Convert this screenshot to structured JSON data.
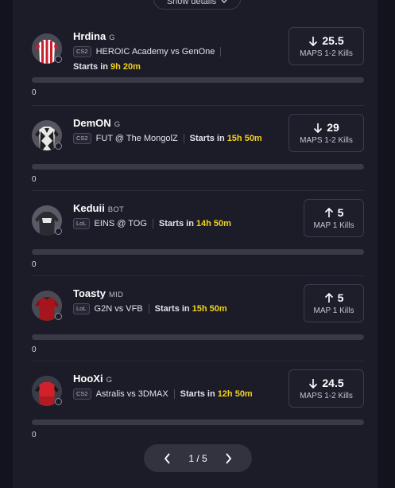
{
  "header": {
    "show_details_label": "Show details"
  },
  "cards": [
    {
      "name": "Hrdina",
      "position": "G",
      "game_tag": "CS2",
      "match": "HEROIC Academy vs GenOne",
      "starts_label": "Starts in",
      "starts_time": "9h 20m",
      "direction": "down",
      "value": "25.5",
      "stat": "MAPS 1-2 Kills",
      "count": "0",
      "jersey": "red-white-stripes"
    },
    {
      "name": "DemON",
      "position": "G",
      "game_tag": "CS2",
      "match": "FUT @ The MongolZ",
      "starts_label": "Starts in",
      "starts_time": "15h 50m",
      "direction": "down",
      "value": "29",
      "stat": "MAPS 1-2 Kills",
      "count": "0",
      "jersey": "black-white-pattern"
    },
    {
      "name": "Keduii",
      "position": "BOT",
      "game_tag": "LoL",
      "match": "EINS @ TOG",
      "starts_label": "Starts in",
      "starts_time": "14h 50m",
      "direction": "up",
      "value": "5",
      "stat": "MAP 1 Kills",
      "count": "0",
      "jersey": "dark-grey"
    },
    {
      "name": "Toasty",
      "position": "MID",
      "game_tag": "LoL",
      "match": "G2N vs VFB",
      "starts_label": "Starts in",
      "starts_time": "15h 50m",
      "direction": "up",
      "value": "5",
      "stat": "MAP 1 Kills",
      "count": "0",
      "jersey": "dark-red"
    },
    {
      "name": "HooXi",
      "position": "G",
      "game_tag": "CS2",
      "match": "Astralis vs 3DMAX",
      "starts_label": "Starts in",
      "starts_time": "12h 50m",
      "direction": "down",
      "value": "24.5",
      "stat": "MAPS 1-2 Kills",
      "count": "0",
      "jersey": "red-black"
    }
  ],
  "pagination": {
    "label": "1 / 5"
  },
  "colors": {
    "accent_time": "#f2d21a",
    "background": "#1c1c28"
  }
}
